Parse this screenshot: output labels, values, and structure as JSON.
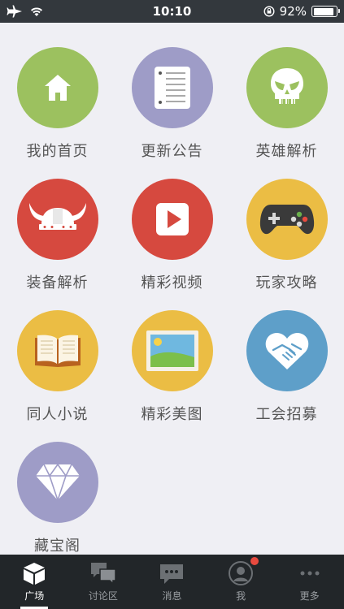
{
  "status_bar": {
    "time": "10:10",
    "battery_text": "92%",
    "battery_level": 0.92,
    "icons": [
      "airplane-icon",
      "wifi-icon",
      "orientation-lock-icon",
      "battery-icon"
    ]
  },
  "grid": {
    "items": [
      {
        "label": "我的首页",
        "color": "#9cc15f",
        "icon": "house-icon"
      },
      {
        "label": "更新公告",
        "color": "#9e9cc7",
        "icon": "notepad-icon"
      },
      {
        "label": "英雄解析",
        "color": "#9cc15f",
        "icon": "skull-icon"
      },
      {
        "label": "装备解析",
        "color": "#d6493f",
        "icon": "horned-helmet-icon"
      },
      {
        "label": "精彩视频",
        "color": "#d6493f",
        "icon": "play-icon"
      },
      {
        "label": "玩家攻略",
        "color": "#ebbd44",
        "icon": "gamepad-icon"
      },
      {
        "label": "同人小说",
        "color": "#ebbd44",
        "icon": "book-icon"
      },
      {
        "label": "精彩美图",
        "color": "#ebbd44",
        "icon": "picture-icon"
      },
      {
        "label": "工会招募",
        "color": "#5e9fc9",
        "icon": "handshake-heart-icon"
      },
      {
        "label": "藏宝阁",
        "color": "#9e9cc7",
        "icon": "diamond-icon"
      }
    ]
  },
  "tab_bar": {
    "tabs": [
      {
        "label": "广场",
        "icon": "cube-icon",
        "active": true
      },
      {
        "label": "讨论区",
        "icon": "chat-bubbles-icon",
        "active": false
      },
      {
        "label": "消息",
        "icon": "message-icon",
        "active": false
      },
      {
        "label": "我",
        "icon": "profile-icon",
        "active": false,
        "badge": true
      },
      {
        "label": "更多",
        "icon": "more-icon",
        "active": false
      }
    ]
  }
}
